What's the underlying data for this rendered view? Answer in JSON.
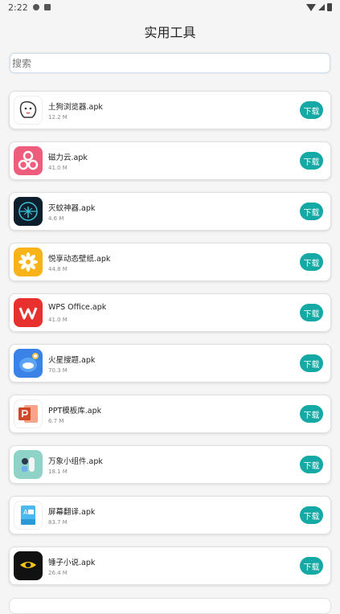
{
  "status": {
    "time": "2:22"
  },
  "header": {
    "title": "实用工具"
  },
  "search": {
    "placeholder": "搜索"
  },
  "apps": [
    {
      "name": "土狗浏览器.apk",
      "size": "12.2 M",
      "icon": "dog-browser-icon",
      "download_label": "下载"
    },
    {
      "name": "磁力云.apk",
      "size": "41.0 M",
      "icon": "magnet-cloud-icon",
      "download_label": "下载"
    },
    {
      "name": "灭蚊神器.apk",
      "size": "4.6 M",
      "icon": "mosquito-icon",
      "download_label": "下载"
    },
    {
      "name": "悦享动态壁纸.apk",
      "size": "44.8 M",
      "icon": "wallpaper-flower-icon",
      "download_label": "下载"
    },
    {
      "name": "WPS Office.apk",
      "size": "41.0 M",
      "icon": "wps-icon",
      "download_label": "下载"
    },
    {
      "name": "火星搜题.apk",
      "size": "70.3 M",
      "icon": "mars-search-icon",
      "download_label": "下载"
    },
    {
      "name": "PPT模板库.apk",
      "size": "6.7 M",
      "icon": "ppt-icon",
      "download_label": "下载"
    },
    {
      "name": "万象小组件.apk",
      "size": "18.1 M",
      "icon": "widget-icon",
      "download_label": "下载"
    },
    {
      "name": "屏幕翻译.apk",
      "size": "83.7 M",
      "icon": "screen-translate-icon",
      "download_label": "下载"
    },
    {
      "name": "锤子小说.apk",
      "size": "26.4 M",
      "icon": "hammer-novel-icon",
      "download_label": "下载"
    }
  ],
  "colors": {
    "accent": "#14a9a5",
    "background": "#f5f5f5"
  }
}
